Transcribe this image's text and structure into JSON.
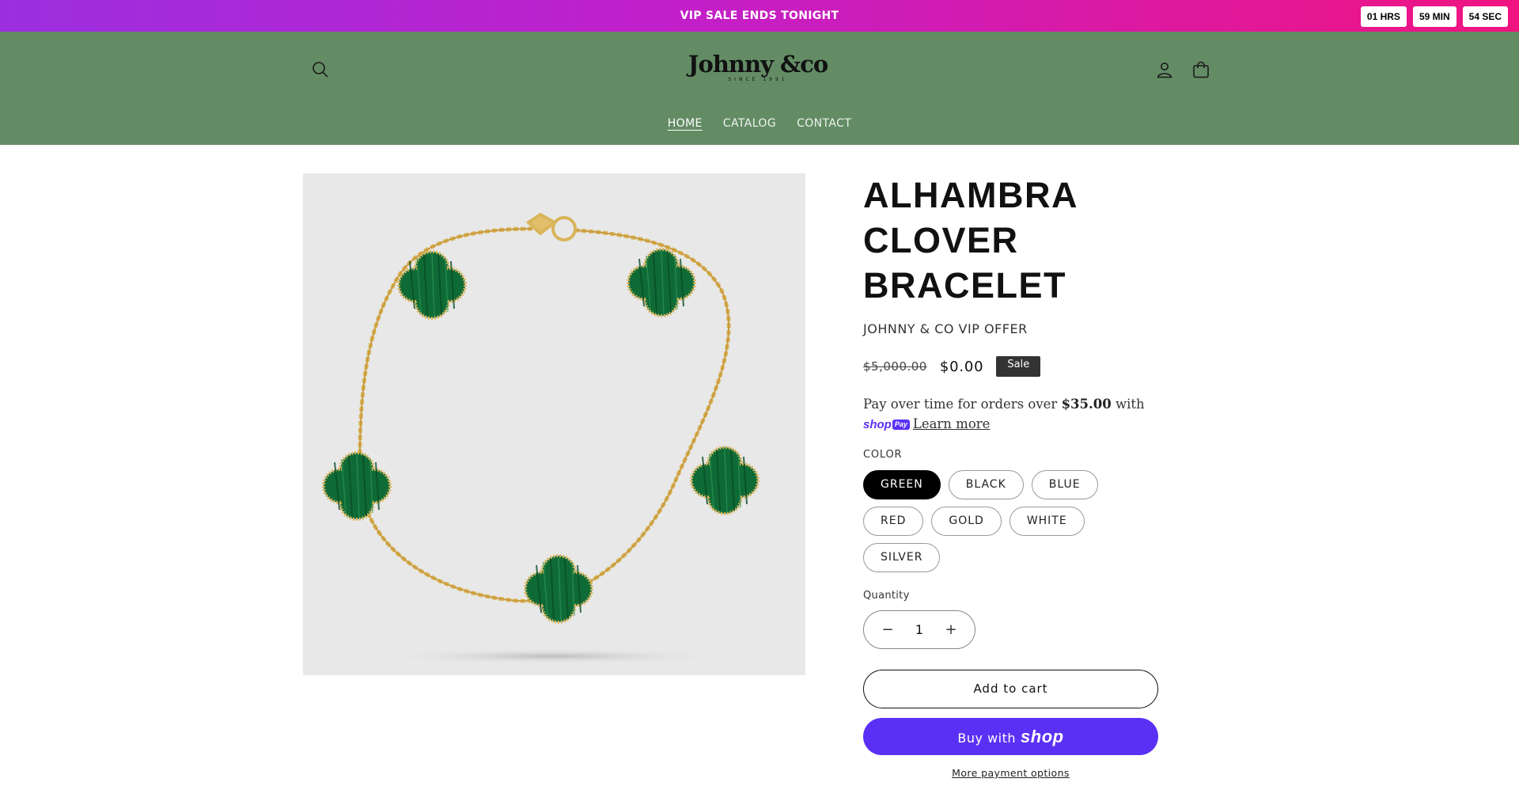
{
  "announcement": {
    "text": "VIP SALE ENDS TONIGHT",
    "countdown": {
      "hours": "01 HRS",
      "minutes": "59 MIN",
      "seconds": "54 SEC"
    }
  },
  "header": {
    "logo_text": "Johnny &co",
    "logo_subtext": "SINCE 1991",
    "nav": [
      {
        "label": "HOME",
        "active": true
      },
      {
        "label": "CATALOG",
        "active": false
      },
      {
        "label": "CONTACT",
        "active": false
      }
    ],
    "icons": [
      "search-icon",
      "account-icon",
      "cart-icon"
    ],
    "background_color": "#638c65"
  },
  "product": {
    "title": "ALHAMBRA CLOVER BRACELET",
    "vendor": "JOHNNY & CO VIP OFFER",
    "price_compare": "$5,000.00",
    "price_sale": "$0.00",
    "badge": "Sale",
    "installments": {
      "text_before": "Pay over time for orders over",
      "amount": "$35.00",
      "text_after": "with",
      "shop_label": "shop",
      "pay_label": "Pay",
      "learn_more": "Learn more"
    },
    "option_label": "COLOR",
    "colors": [
      "GREEN",
      "BLACK",
      "BLUE",
      "RED",
      "GOLD",
      "WHITE",
      "SILVER"
    ],
    "selected_color": "GREEN",
    "quantity_label": "Quantity",
    "quantity": "1",
    "add_to_cart": "Add to cart",
    "buy_with": "Buy with",
    "buy_with_brand": "shop",
    "more_payment": "More payment options"
  },
  "colors": {
    "shop_purple": "#5a31f4",
    "malachite_green": "#0f6b36",
    "gold": "#d9b45a"
  }
}
